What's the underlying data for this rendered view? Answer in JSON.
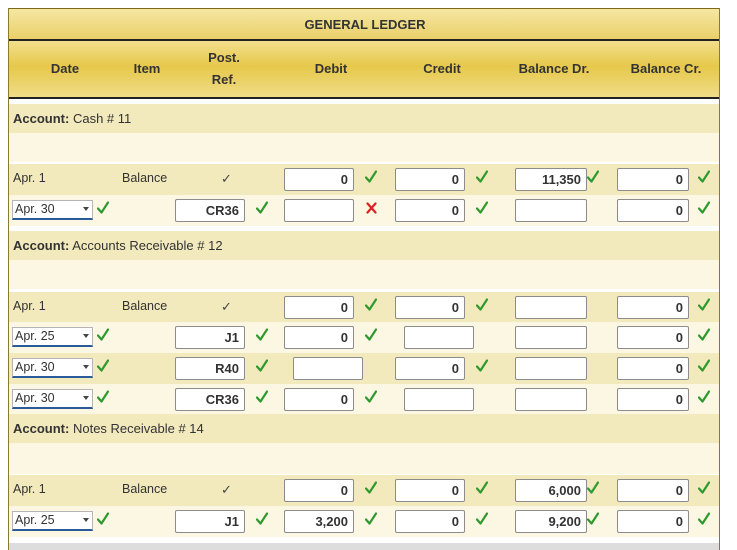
{
  "title": "GENERAL LEDGER",
  "headers": {
    "date": "Date",
    "item": "Item",
    "post_ref_line1": "Post.",
    "post_ref_line2": "Ref.",
    "debit": "Debit",
    "credit": "Credit",
    "balance_dr": "Balance Dr.",
    "balance_cr": "Balance Cr."
  },
  "accounts": [
    {
      "label": "Account:",
      "name": "Cash # 11",
      "rows": [
        {
          "date": "Apr. 1",
          "item": "Balance",
          "ref": "✓",
          "debit": "0",
          "credit": "0",
          "bal_dr": "11,350",
          "bal_cr": "0"
        },
        {
          "date": "Apr. 30",
          "item": "",
          "ref": "CR36",
          "debit": "",
          "credit": "0",
          "bal_dr": "",
          "bal_cr": "0"
        }
      ]
    },
    {
      "label": "Account:",
      "name": "Accounts Receivable # 12",
      "rows": [
        {
          "date": "Apr. 1",
          "item": "Balance",
          "ref": "✓",
          "debit": "0",
          "credit": "0",
          "bal_dr": "",
          "bal_cr": "0"
        },
        {
          "date": "Apr. 25",
          "item": "",
          "ref": "J1",
          "debit": "0",
          "credit": "",
          "bal_dr": "",
          "bal_cr": "0"
        },
        {
          "date": "Apr. 30",
          "item": "",
          "ref": "R40",
          "debit": "",
          "credit": "0",
          "bal_dr": "",
          "bal_cr": "0"
        },
        {
          "date": "Apr. 30",
          "item": "",
          "ref": "CR36",
          "debit": "0",
          "credit": "",
          "bal_dr": "",
          "bal_cr": "0"
        }
      ]
    },
    {
      "label": "Account:",
      "name": "Notes Receivable # 14",
      "rows": [
        {
          "date": "Apr. 1",
          "item": "Balance",
          "ref": "✓",
          "debit": "0",
          "credit": "0",
          "bal_dr": "6,000",
          "bal_cr": "0"
        },
        {
          "date": "Apr. 25",
          "item": "",
          "ref": "J1",
          "debit": "3,200",
          "credit": "0",
          "bal_dr": "9,200",
          "bal_cr": "0"
        }
      ]
    }
  ],
  "colors": {
    "check": "#2e9a2e",
    "error": "#e02020",
    "band": "#f2e9bd",
    "header": "#e6c84a"
  },
  "icons": {
    "check": "check-icon",
    "error": "x-icon",
    "dropdown": "chevron-down-icon"
  }
}
